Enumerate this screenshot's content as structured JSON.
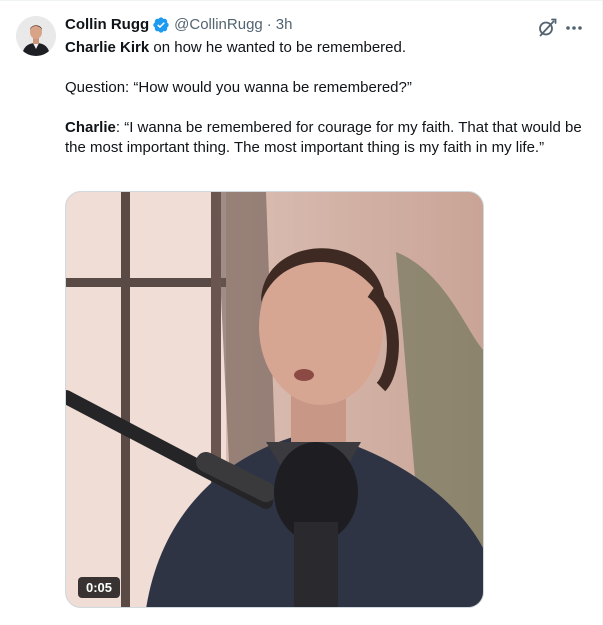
{
  "author": {
    "name": "Collin Rugg",
    "handle": "@CollinRugg",
    "separator": "·",
    "time": "3h",
    "verified_color": "#1d9bf0"
  },
  "tweet": {
    "line1_bold": "Charlie Kirk",
    "line1_rest": " on how he wanted to be remembered.",
    "question": "Question: “How would you wanna be remembered?”",
    "answer_bold": "Charlie",
    "answer_rest": ": “I wanna be remembered for courage for my faith. That that would be the most important thing. The most important thing is my faith in my life.”"
  },
  "media": {
    "duration": "0:05"
  },
  "icons": {
    "grok": "grok-icon",
    "more": "more-icon",
    "verified": "verified-badge-icon"
  }
}
